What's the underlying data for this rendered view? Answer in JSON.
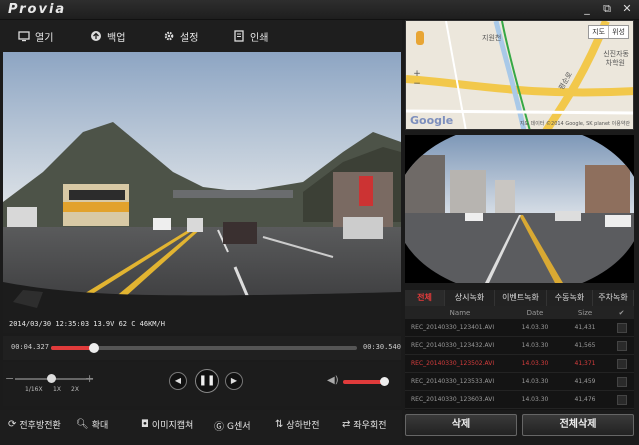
{
  "app": {
    "logo": "Provia"
  },
  "window": {
    "min_icon": "minimize-icon",
    "max_icon": "maximize-icon",
    "close_icon": "close-icon",
    "min": "_",
    "max": "⧉",
    "close": "✕"
  },
  "toolbar": {
    "open": "열기",
    "backup": "백업",
    "settings": "설정",
    "print": "인쇄"
  },
  "video": {
    "timestamp": "2014/03/30 12:35:03  13.9V  62 C  46KM/H"
  },
  "timeline": {
    "current": "00:04.327",
    "total": "00:30.540",
    "progress": 0.14
  },
  "controls": {
    "zoom_labels": [
      "1/16X",
      "1X",
      "2X"
    ],
    "zoom_level": "1X",
    "prev": "◀",
    "pause": "❚❚",
    "next": "▶",
    "volume": 1.0
  },
  "bottom": {
    "front_rear": "전후방전환",
    "enlarge": "확대",
    "capture": "이미지캡쳐",
    "gsensor": "G센서",
    "flip_vertical": "상하반전",
    "flip_horizontal": "좌우회전"
  },
  "map": {
    "type_map": "지도",
    "type_satellite": "위성",
    "zoom_in": "+",
    "zoom_out": "−",
    "google": "Google",
    "copyright": "지도 데이터 ©2014 Google, SK planet  이용약관",
    "place_1": "신진자동",
    "place_2": "차학원",
    "place_3": "지원천",
    "road": "평순로"
  },
  "tabs": [
    "전체",
    "상시녹화",
    "이벤트녹화",
    "수동녹화",
    "주차녹화"
  ],
  "list": {
    "headers": {
      "name": "Name",
      "date": "Date",
      "size": "Size",
      "check": "✔"
    },
    "rows": [
      {
        "name": "REC_20140330_123401.AVI",
        "date": "14.03.30",
        "size": "41,431",
        "selected": false
      },
      {
        "name": "REC_20140330_123432.AVI",
        "date": "14.03.30",
        "size": "41,565",
        "selected": false
      },
      {
        "name": "REC_20140330_123502.AVI",
        "date": "14.03.30",
        "size": "41,371",
        "selected": true
      },
      {
        "name": "REC_20140330_123533.AVI",
        "date": "14.03.30",
        "size": "41,459",
        "selected": false
      },
      {
        "name": "REC_20140330_123603.AVI",
        "date": "14.03.30",
        "size": "41,476",
        "selected": false
      }
    ]
  },
  "actions": {
    "delete": "삭제",
    "delete_all": "전체삭제"
  },
  "colors": {
    "accent": "#e03b3b",
    "background": "#1b1b1b"
  }
}
